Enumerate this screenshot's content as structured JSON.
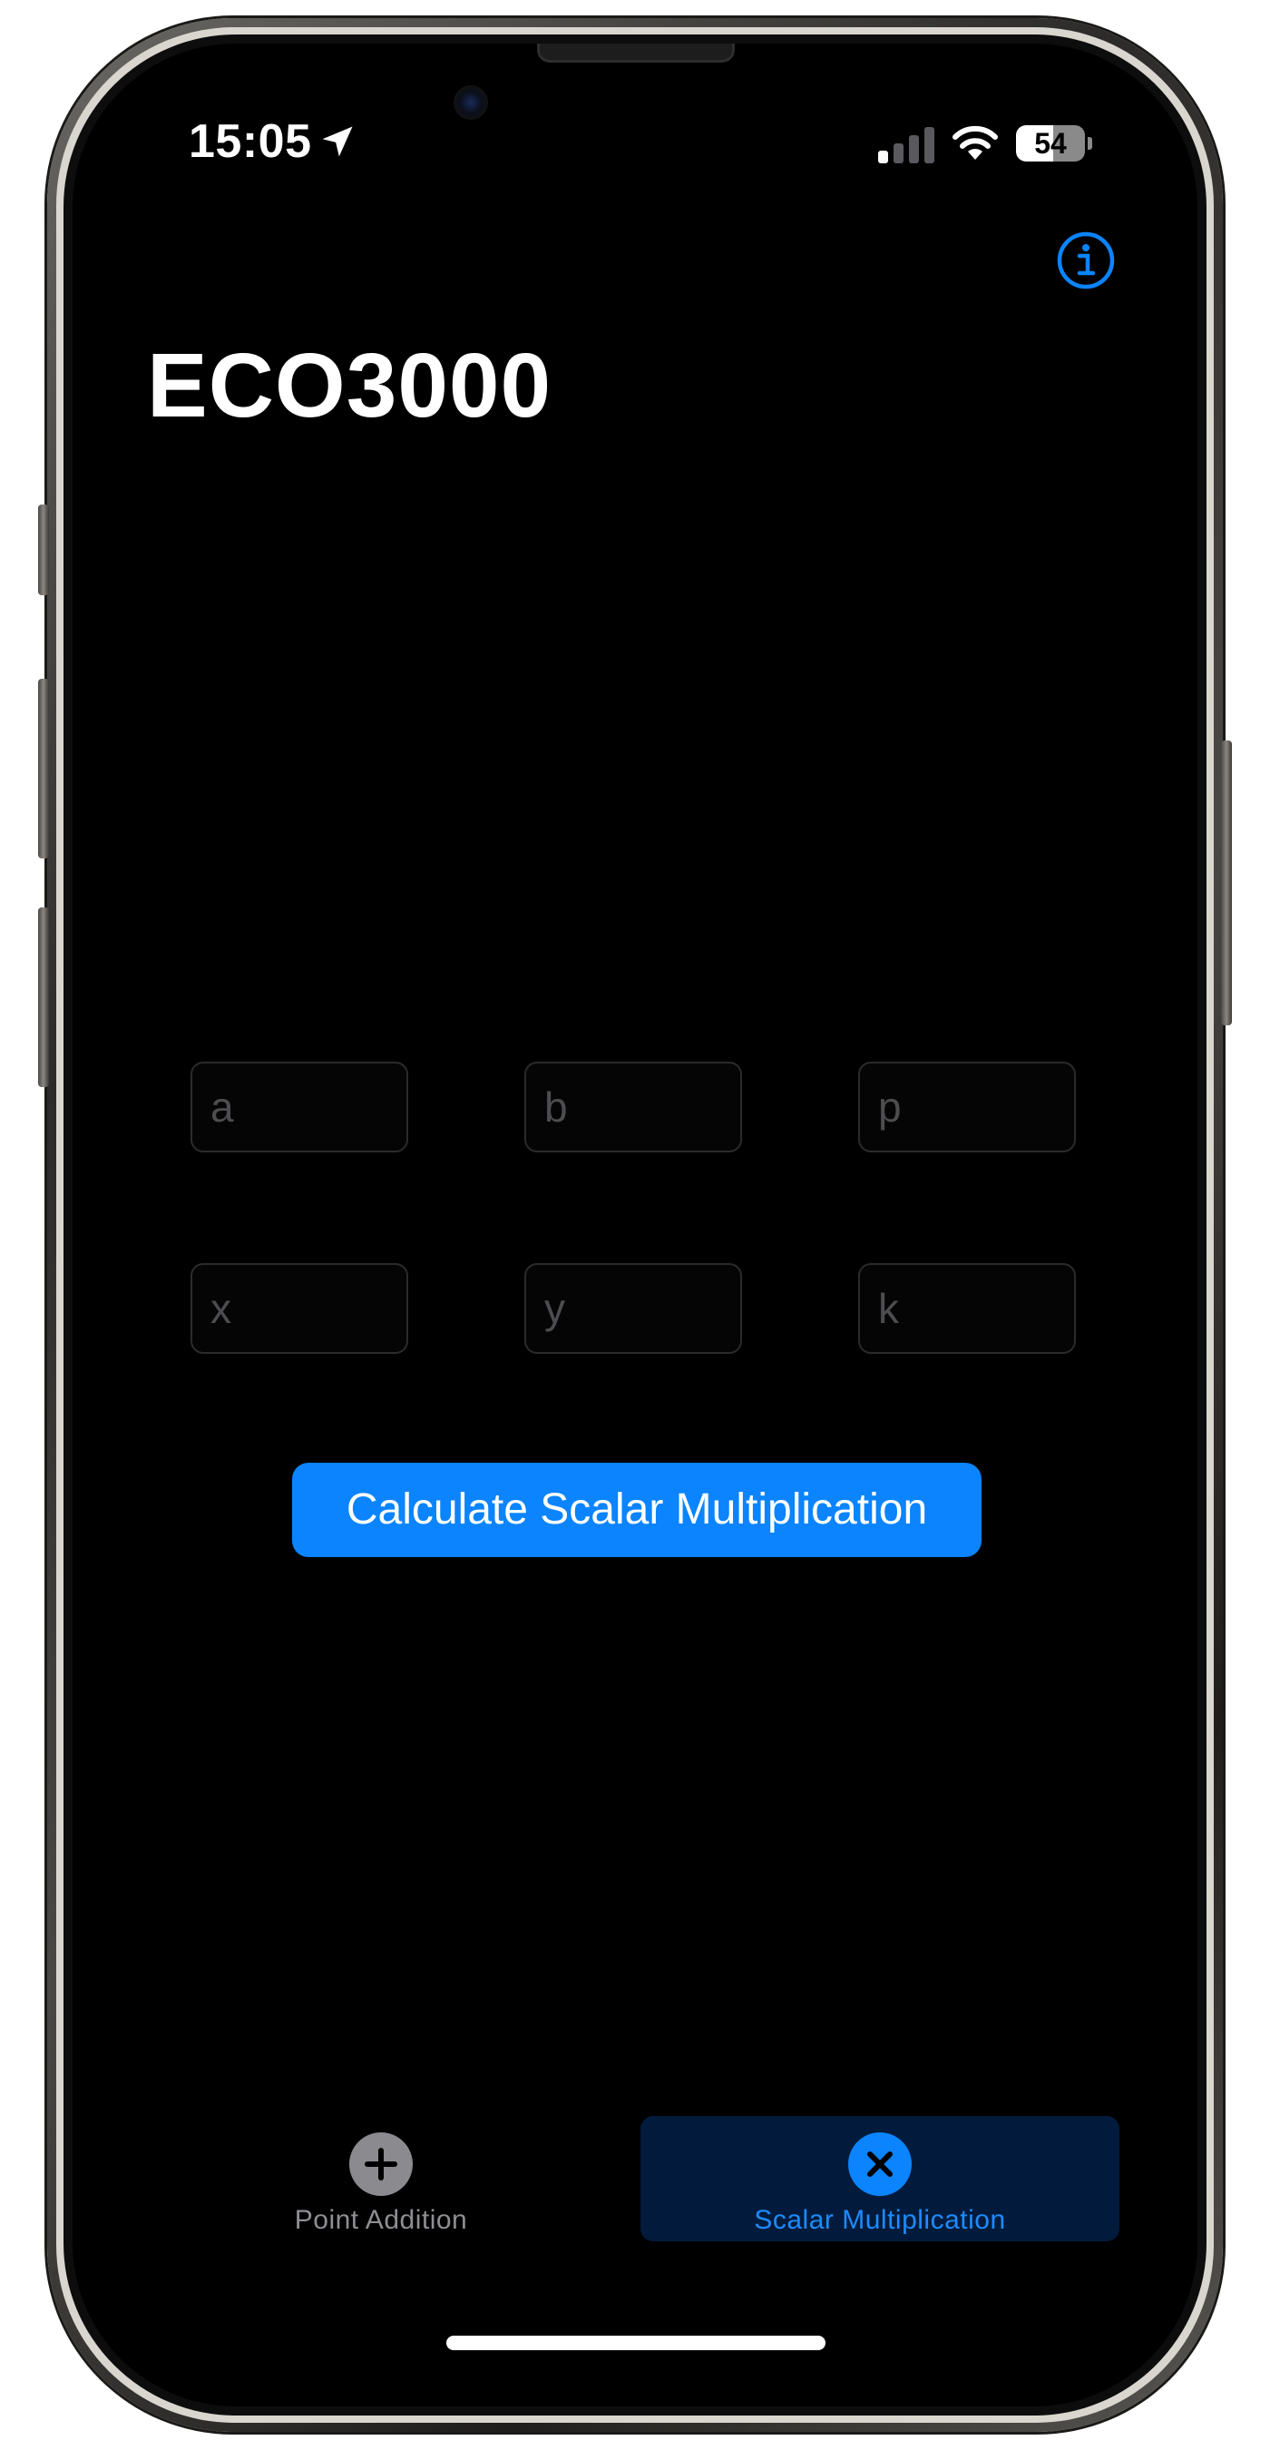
{
  "status_bar": {
    "time": "15:05",
    "battery_level": "54",
    "location_icon": "location-arrow-icon",
    "signal_icon": "cellular-signal-icon",
    "wifi_icon": "wifi-icon"
  },
  "header": {
    "title": "ECO3000",
    "info_icon": "info-circle-icon"
  },
  "form": {
    "a": {
      "placeholder": "a",
      "value": ""
    },
    "b": {
      "placeholder": "b",
      "value": ""
    },
    "p": {
      "placeholder": "p",
      "value": ""
    },
    "x": {
      "placeholder": "x",
      "value": ""
    },
    "y": {
      "placeholder": "y",
      "value": ""
    },
    "k": {
      "placeholder": "k",
      "value": ""
    },
    "submit_label": "Calculate Scalar Multiplication"
  },
  "tab_bar": {
    "tabs": [
      {
        "label": "Point Addition",
        "icon": "plus-circle-icon",
        "selected": false
      },
      {
        "label": "Scalar Multiplication",
        "icon": "xmark-circle-icon",
        "selected": true
      }
    ]
  },
  "colors": {
    "accent": "#0b84fe",
    "background": "#000000",
    "selected_tab_bg": "#021b3c",
    "inactive_tab": "#8e8e93"
  }
}
